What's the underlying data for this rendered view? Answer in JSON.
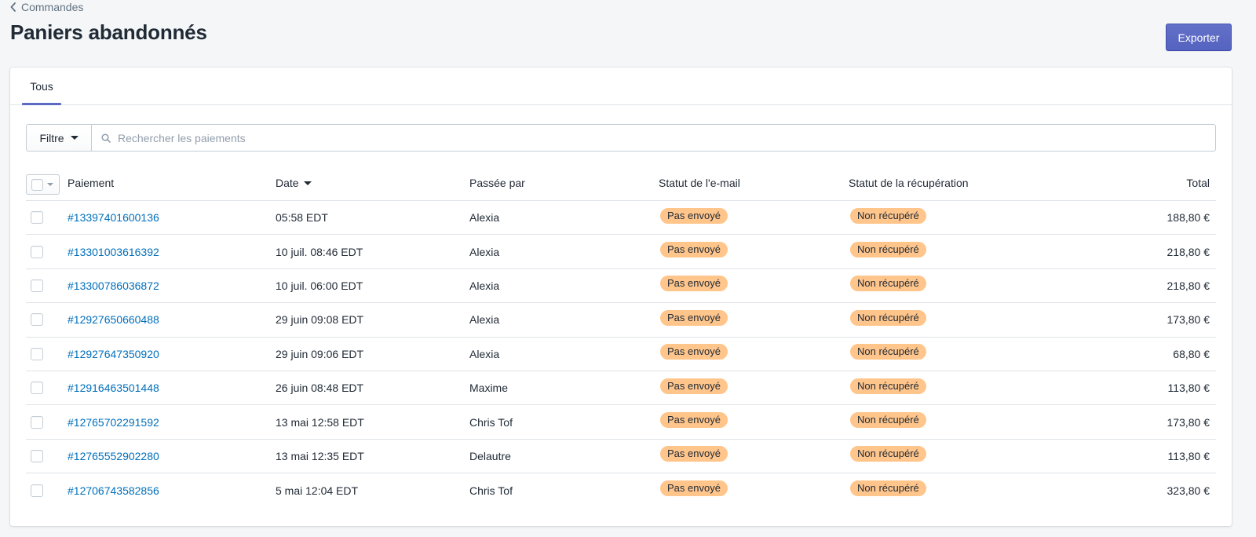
{
  "breadcrumb": {
    "label": "Commandes",
    "icon": "chevron-left-icon"
  },
  "page_title": "Paniers abandonnés",
  "export_button": "Exporter",
  "colors": {
    "accent": "#5c6ac4",
    "link": "#006fbb",
    "badge_attention": "#ffc58b",
    "background": "#f4f6f8"
  },
  "tabs": [
    {
      "label": "Tous",
      "selected": true
    }
  ],
  "filter": {
    "button_label": "Filtre",
    "search_placeholder": "Rechercher les paiements",
    "search_value": ""
  },
  "table": {
    "columns": {
      "payment": "Paiement",
      "date": "Date",
      "placed_by": "Passée par",
      "email_status": "Statut de l'e-mail",
      "recovery_status": "Statut de la récupération",
      "total": "Total"
    },
    "sort": {
      "column": "Date",
      "direction": "descending"
    },
    "rows": [
      {
        "id": "#13397401600136",
        "date": "05:58 EDT",
        "by": "Alexia",
        "email": "Pas envoyé",
        "recovery": "Non récupéré",
        "total": "188,80 €"
      },
      {
        "id": "#13301003616392",
        "date": "10 juil. 08:46 EDT",
        "by": "Alexia",
        "email": "Pas envoyé",
        "recovery": "Non récupéré",
        "total": "218,80 €"
      },
      {
        "id": "#13300786036872",
        "date": "10 juil. 06:00 EDT",
        "by": "Alexia",
        "email": "Pas envoyé",
        "recovery": "Non récupéré",
        "total": "218,80 €"
      },
      {
        "id": "#12927650660488",
        "date": "29 juin 09:08 EDT",
        "by": "Alexia",
        "email": "Pas envoyé",
        "recovery": "Non récupéré",
        "total": "173,80 €"
      },
      {
        "id": "#12927647350920",
        "date": "29 juin 09:06 EDT",
        "by": "Alexia",
        "email": "Pas envoyé",
        "recovery": "Non récupéré",
        "total": "68,80 €"
      },
      {
        "id": "#12916463501448",
        "date": "26 juin 08:48 EDT",
        "by": "Maxime",
        "email": "Pas envoyé",
        "recovery": "Non récupéré",
        "total": "113,80 €"
      },
      {
        "id": "#12765702291592",
        "date": "13 mai 12:58 EDT",
        "by": "Chris Tof",
        "email": "Pas envoyé",
        "recovery": "Non récupéré",
        "total": "173,80 €"
      },
      {
        "id": "#12765552902280",
        "date": "13 mai 12:35 EDT",
        "by": "Delautre",
        "email": "Pas envoyé",
        "recovery": "Non récupéré",
        "total": "113,80 €"
      },
      {
        "id": "#12706743582856",
        "date": "5 mai 12:04 EDT",
        "by": "Chris Tof",
        "email": "Pas envoyé",
        "recovery": "Non récupéré",
        "total": "323,80 €"
      }
    ]
  }
}
